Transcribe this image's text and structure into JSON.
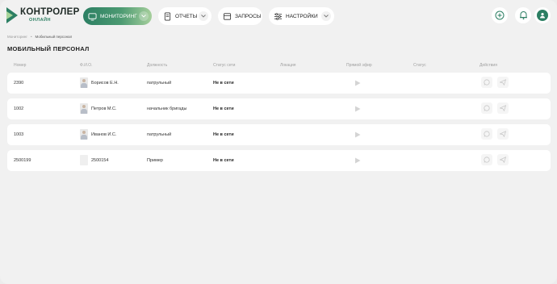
{
  "app": {
    "logo_title": "КОНТРОЛЕР",
    "logo_sub": "ОНЛАЙН",
    "brand_color": "#2c7f63"
  },
  "nav": [
    {
      "label": "МОНИТОРИНГ",
      "icon": "monitor-icon",
      "active": true
    },
    {
      "label": "ОТЧЕТЫ",
      "icon": "report-icon",
      "active": false
    },
    {
      "label": "ЗАПРОСЫ",
      "icon": "request-icon",
      "active": false
    },
    {
      "label": "НАСТРОЙКИ",
      "icon": "settings-sliders-icon",
      "active": false
    }
  ],
  "header_actions": [
    "add-icon",
    "bell-icon",
    "user-avatar-icon"
  ],
  "breadcrumb": {
    "root": "Мониторинг",
    "current": "Мобильный персонал"
  },
  "page_title": "МОБИЛЬНЫЙ ПЕРСОНАЛ",
  "table": {
    "columns": [
      "Номер",
      "Ф.И.О.",
      "Должность",
      "Статус сети",
      "Локация",
      "Прямой эфир",
      "Статус",
      "Действия"
    ],
    "rows": [
      {
        "number": "2390",
        "name": "Борисов Е.Н.",
        "position": "патрульный",
        "network_status": "Не в сети",
        "location": "",
        "status": "",
        "has_photo": true
      },
      {
        "number": "1002",
        "name": "Петров М.С.",
        "position": "начальник бригады",
        "network_status": "Не в сети",
        "location": "",
        "status": "",
        "has_photo": true
      },
      {
        "number": "1003",
        "name": "Иванов И.С.",
        "position": "патрульный",
        "network_status": "Не в сети",
        "location": "",
        "status": "",
        "has_photo": true
      },
      {
        "number": "2500199",
        "name": "2500154",
        "position": "Пример",
        "network_status": "Не в сети",
        "location": "",
        "status": "",
        "has_photo": false
      }
    ],
    "row_icons": [
      "play-icon",
      "whatsapp-icon",
      "send-icon"
    ]
  }
}
